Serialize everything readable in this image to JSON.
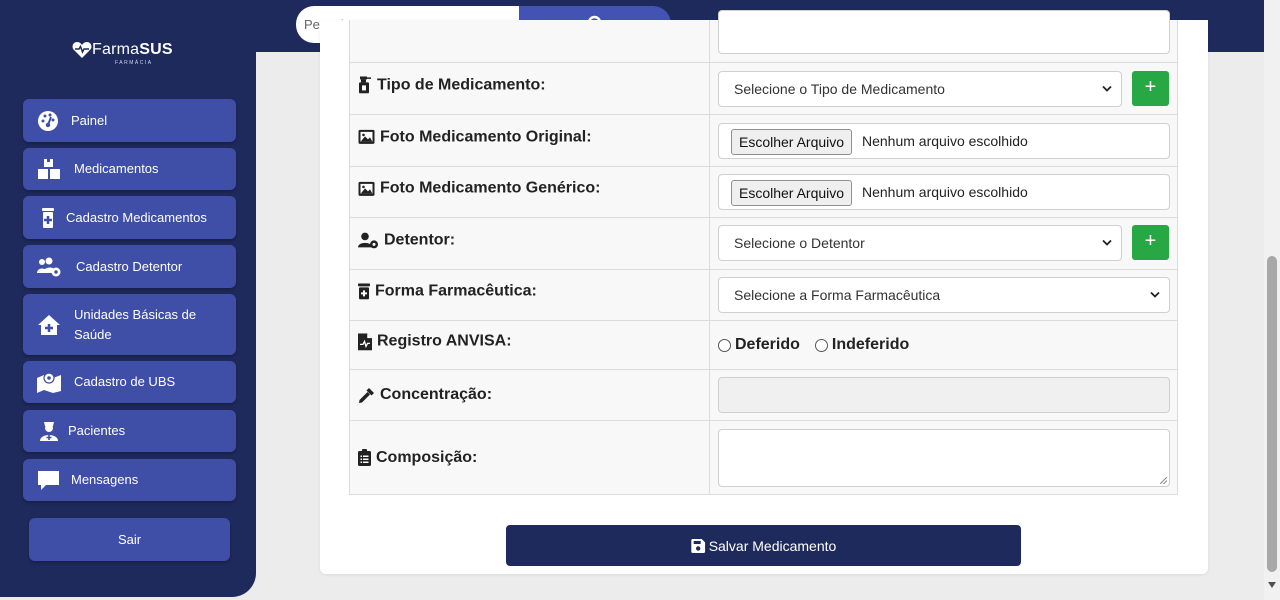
{
  "brand": {
    "name_light": "Farma",
    "name_bold": "SUS",
    "subtitle": "FARMÁCIA"
  },
  "sidebar": {
    "items": [
      {
        "label": "Painel",
        "icon": "gauge-icon"
      },
      {
        "label": "Medicamentos",
        "icon": "boxes-icon"
      },
      {
        "label": "Cadastro Medicamentos",
        "icon": "pill-bottle-icon"
      },
      {
        "label": "Cadastro Detentor",
        "icon": "users-gear-icon"
      },
      {
        "label": "Unidades Básicas de Saúde",
        "icon": "house-medical-icon"
      },
      {
        "label": "Cadastro de UBS",
        "icon": "map-location-icon"
      },
      {
        "label": "Pacientes",
        "icon": "user-nurse-icon"
      },
      {
        "label": "Mensagens",
        "icon": "message-icon"
      }
    ],
    "logout_label": "Sair"
  },
  "search": {
    "placeholder": "Pesquisar...",
    "value": ""
  },
  "form": {
    "tipo": {
      "label": "Tipo de Medicamento:",
      "selected": "Selecione o Tipo de Medicamento"
    },
    "foto_original": {
      "label": "Foto Medicamento Original:",
      "button": "Escolher Arquivo",
      "status": "Nenhum arquivo escolhido"
    },
    "foto_generico": {
      "label": "Foto Medicamento Genérico:",
      "button": "Escolher Arquivo",
      "status": "Nenhum arquivo escolhido"
    },
    "detentor": {
      "label": "Detentor:",
      "selected": "Selecione o Detentor"
    },
    "forma": {
      "label": "Forma Farmacêutica:",
      "selected": "Selecione a Forma Farmacêutica"
    },
    "registro": {
      "label": "Registro ANVISA:",
      "options": [
        "Deferido",
        "Indeferido"
      ]
    },
    "concentracao": {
      "label": "Concentração:",
      "value": ""
    },
    "composicao": {
      "label": "Composição:",
      "value": ""
    },
    "add_button": "+",
    "save_label": "Salvar Medicamento"
  },
  "colors": {
    "navy": "#1f2a5c",
    "nav_item": "#3f4ea6",
    "accent": "#4353b3",
    "success": "#28a745"
  }
}
